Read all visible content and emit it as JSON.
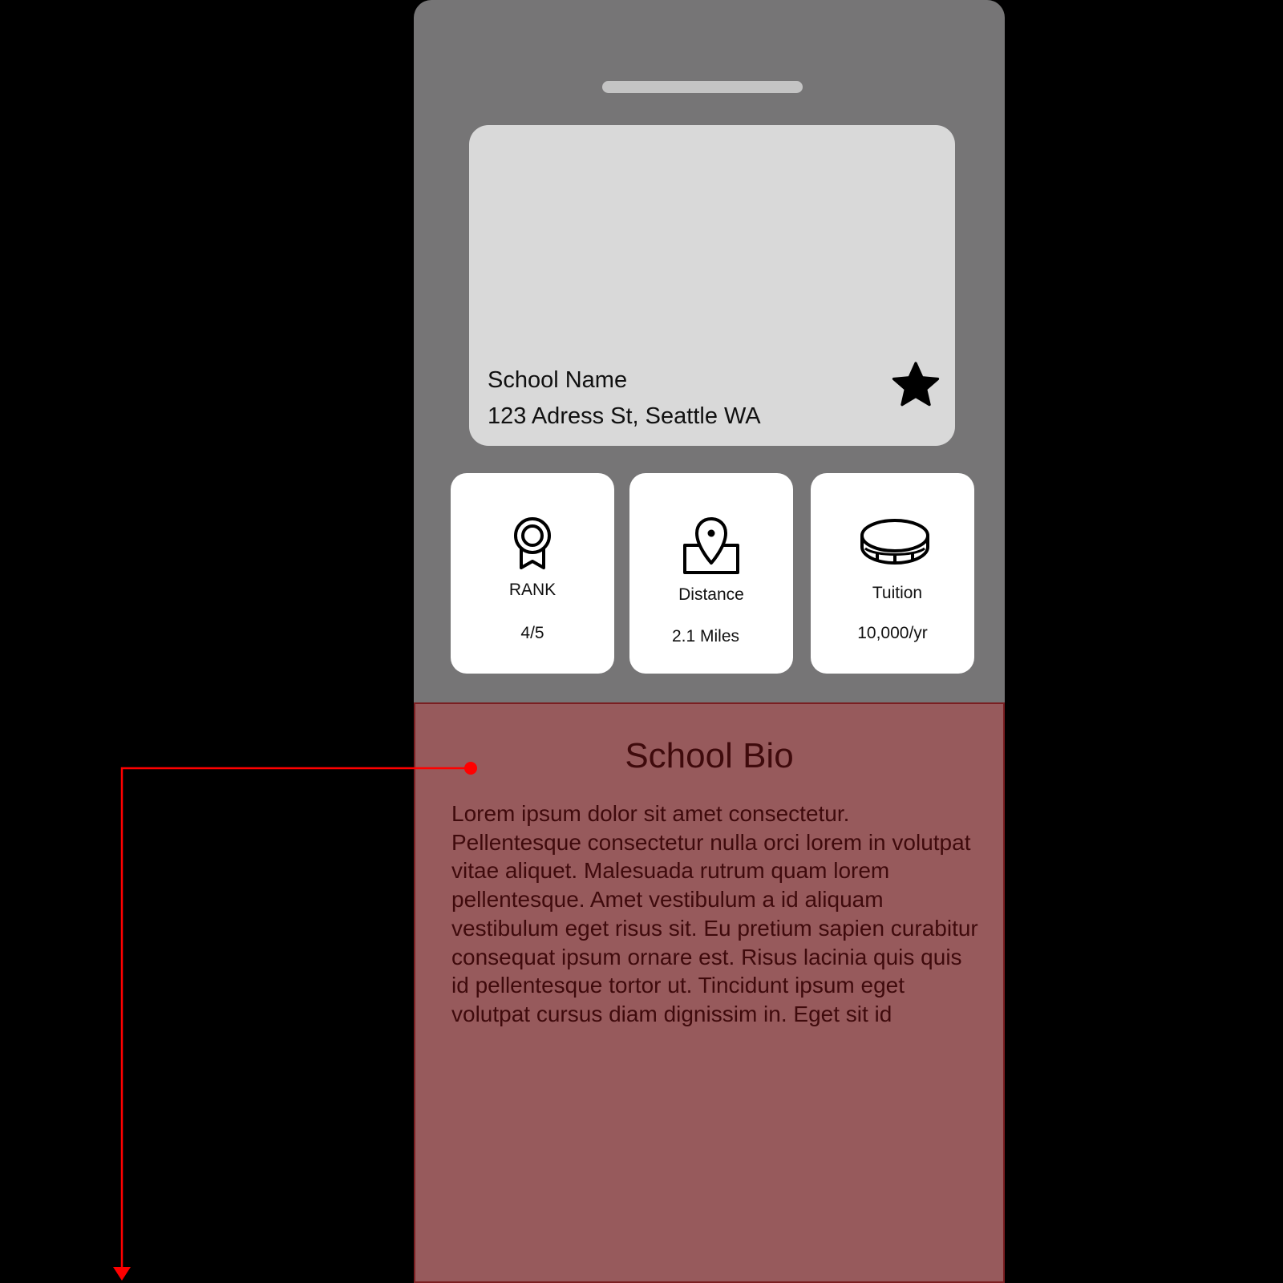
{
  "colors": {
    "background": "#000000",
    "phone": "#767576",
    "hero_card": "#d9d9d9",
    "stat_card": "#ffffff",
    "bio_panel": "#975a5c",
    "bio_text": "#3f0a0c",
    "annotation": "#ff0000"
  },
  "school": {
    "name": "School Name",
    "address": "123 Adress St, Seattle WA",
    "favorite_icon": "star-icon"
  },
  "stats": [
    {
      "icon": "award-ribbon-icon",
      "label": "RANK",
      "value": "4/5"
    },
    {
      "icon": "map-pin-icon",
      "label": "Distance",
      "value": "2.1 Miles"
    },
    {
      "icon": "coin-icon",
      "label": "Tuition",
      "value": "10,000/yr"
    }
  ],
  "bio": {
    "title": "School Bio",
    "text": "Lorem ipsum dolor sit amet consectetur. Pellentesque consectetur nulla orci lorem in volutpat vitae aliquet. Malesuada rutrum quam lorem pellentesque. Amet vestibulum a id aliquam vestibulum eget risus sit. Eu pretium sapien curabitur consequat ipsum ornare est. Risus lacinia quis quis id pellentesque tortor ut. Tincidunt ipsum eget volutpat cursus diam dignissim in. Eget sit id"
  }
}
